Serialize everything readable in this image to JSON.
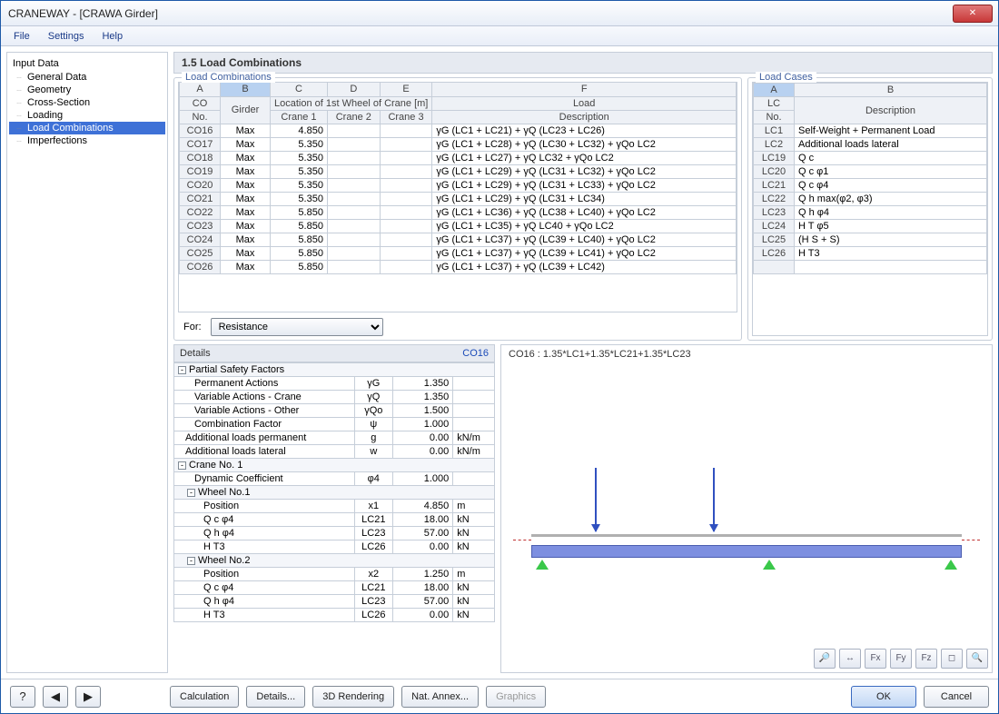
{
  "window": {
    "title": "CRANEWAY - [CRAWA Girder]"
  },
  "menu": {
    "file": "File",
    "settings": "Settings",
    "help": "Help"
  },
  "tree": {
    "title": "Input Data",
    "items": [
      "General Data",
      "Geometry",
      "Cross-Section",
      "Loading",
      "Load Combinations",
      "Imperfections"
    ],
    "selectedIndex": 4
  },
  "section": {
    "title": "1.5 Load Combinations"
  },
  "loadCombos": {
    "legend": "Load Combinations",
    "colA": "A",
    "colB": "B",
    "colC": "C",
    "colD": "D",
    "colE": "E",
    "colF": "F",
    "hdr_co": "CO",
    "hdr_no": "No.",
    "hdr_girder": "Girder",
    "hdr_loc_group": "Location of 1st Wheel of Crane [m]",
    "hdr_crane1": "Crane 1",
    "hdr_crane2": "Crane 2",
    "hdr_crane3": "Crane 3",
    "hdr_load": "Load",
    "hdr_desc": "Description",
    "rows": [
      {
        "no": "CO16",
        "girder": "Max",
        "c1": "4.850",
        "desc": "γG (LC1 + LC21) + γQ (LC23 + LC26)"
      },
      {
        "no": "CO17",
        "girder": "Max",
        "c1": "5.350",
        "desc": "γG (LC1 + LC28) + γQ (LC30 + LC32) + γQo LC2"
      },
      {
        "no": "CO18",
        "girder": "Max",
        "c1": "5.350",
        "desc": "γG (LC1 + LC27) + γQ LC32 + γQo LC2"
      },
      {
        "no": "CO19",
        "girder": "Max",
        "c1": "5.350",
        "desc": "γG (LC1 + LC29) + γQ (LC31 + LC32) + γQo LC2"
      },
      {
        "no": "CO20",
        "girder": "Max",
        "c1": "5.350",
        "desc": "γG (LC1 + LC29) + γQ (LC31 + LC33) + γQo LC2"
      },
      {
        "no": "CO21",
        "girder": "Max",
        "c1": "5.350",
        "desc": "γG (LC1 + LC29) + γQ (LC31 + LC34)"
      },
      {
        "no": "CO22",
        "girder": "Max",
        "c1": "5.850",
        "desc": "γG (LC1 + LC36) + γQ (LC38 + LC40) + γQo LC2"
      },
      {
        "no": "CO23",
        "girder": "Max",
        "c1": "5.850",
        "desc": "γG (LC1 + LC35) + γQ LC40 + γQo LC2"
      },
      {
        "no": "CO24",
        "girder": "Max",
        "c1": "5.850",
        "desc": "γG (LC1 + LC37) + γQ (LC39 + LC40) + γQo LC2"
      },
      {
        "no": "CO25",
        "girder": "Max",
        "c1": "5.850",
        "desc": "γG (LC1 + LC37) + γQ (LC39 + LC41) + γQo LC2"
      },
      {
        "no": "CO26",
        "girder": "Max",
        "c1": "5.850",
        "desc": "γG (LC1 + LC37) + γQ (LC39 + LC42)"
      }
    ]
  },
  "loadCases": {
    "legend": "Load Cases",
    "colA": "A",
    "colB": "B",
    "hdr_lc": "LC",
    "hdr_no": "No.",
    "hdr_desc": "Description",
    "rows": [
      {
        "no": "LC1",
        "desc": "Self-Weight + Permanent Load"
      },
      {
        "no": "LC2",
        "desc": "Additional loads lateral"
      },
      {
        "no": "LC19",
        "desc": "Q c"
      },
      {
        "no": "LC20",
        "desc": "Q c φ1"
      },
      {
        "no": "LC21",
        "desc": "Q c φ4"
      },
      {
        "no": "LC22",
        "desc": "Q h max(φ2, φ3)"
      },
      {
        "no": "LC23",
        "desc": "Q h φ4"
      },
      {
        "no": "LC24",
        "desc": "H T φ5"
      },
      {
        "no": "LC25",
        "desc": "(H S + S)"
      },
      {
        "no": "LC26",
        "desc": "H T3"
      }
    ]
  },
  "for": {
    "label": "For:",
    "value": "Resistance"
  },
  "details": {
    "title": "Details",
    "co": "CO16",
    "groups": {
      "psf": "Partial Safety Factors",
      "crane1": "Crane No. 1",
      "wheel1": "Wheel No.1",
      "wheel2": "Wheel No.2"
    },
    "rows": {
      "perm_act": {
        "k": "Permanent Actions",
        "s": "γG",
        "v": "1.350",
        "u": ""
      },
      "var_crane": {
        "k": "Variable Actions - Crane",
        "s": "γQ",
        "v": "1.350",
        "u": ""
      },
      "var_other": {
        "k": "Variable Actions - Other",
        "s": "γQo",
        "v": "1.500",
        "u": ""
      },
      "comb": {
        "k": "Combination Factor",
        "s": "ψ",
        "v": "1.000",
        "u": ""
      },
      "add_perm": {
        "k": "Additional loads permanent",
        "s": "g",
        "v": "0.00",
        "u": "kN/m"
      },
      "add_lat": {
        "k": "Additional loads lateral",
        "s": "w",
        "v": "0.00",
        "u": "kN/m"
      },
      "dyn": {
        "k": "Dynamic Coefficient",
        "s": "φ4",
        "v": "1.000",
        "u": ""
      },
      "w1_pos": {
        "k": "Position",
        "s": "x1",
        "v": "4.850",
        "u": "m"
      },
      "w1_qc": {
        "k": "Q c φ4",
        "s": "LC21",
        "v": "18.00",
        "u": "kN"
      },
      "w1_qh": {
        "k": "Q h φ4",
        "s": "LC23",
        "v": "57.00",
        "u": "kN"
      },
      "w1_ht": {
        "k": "H T3",
        "s": "LC26",
        "v": "0.00",
        "u": "kN"
      },
      "w2_pos": {
        "k": "Position",
        "s": "x2",
        "v": "1.250",
        "u": "m"
      },
      "w2_qc": {
        "k": "Q c φ4",
        "s": "LC21",
        "v": "18.00",
        "u": "kN"
      },
      "w2_qh": {
        "k": "Q h φ4",
        "s": "LC23",
        "v": "57.00",
        "u": "kN"
      },
      "w2_ht": {
        "k": "H T3",
        "s": "LC26",
        "v": "0.00",
        "u": "kN"
      }
    }
  },
  "preview": {
    "formula": "CO16 : 1.35*LC1+1.35*LC21+1.35*LC23"
  },
  "buttons": {
    "calculation": "Calculation",
    "details": "Details...",
    "rendering": "3D Rendering",
    "annex": "Nat. Annex...",
    "graphics": "Graphics",
    "ok": "OK",
    "cancel": "Cancel"
  }
}
